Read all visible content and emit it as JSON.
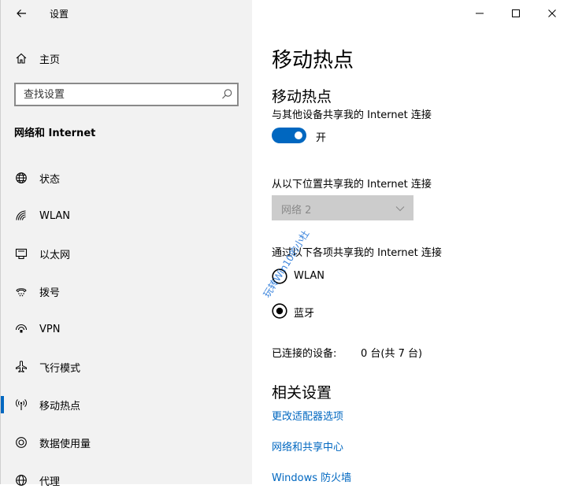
{
  "window": {
    "title": "设置",
    "controls": [
      "minimize",
      "maximize",
      "close"
    ]
  },
  "sidebar": {
    "home_label": "主页",
    "search": {
      "placeholder": "查找设置",
      "value": ""
    },
    "section_title": "网络和 Internet",
    "items": [
      {
        "label": "状态",
        "icon": "globe-icon"
      },
      {
        "label": "WLAN",
        "icon": "wifi-icon"
      },
      {
        "label": "以太网",
        "icon": "ethernet-icon"
      },
      {
        "label": "拨号",
        "icon": "dialup-icon"
      },
      {
        "label": "VPN",
        "icon": "vpn-icon"
      },
      {
        "label": "飞行模式",
        "icon": "airplane-icon"
      },
      {
        "label": "移动热点",
        "icon": "hotspot-icon",
        "active": true
      },
      {
        "label": "数据使用量",
        "icon": "data-usage-icon"
      },
      {
        "label": "代理",
        "icon": "globe-icon"
      }
    ]
  },
  "main": {
    "page_title": "移动热点",
    "section_title": "移动热点",
    "share_desc": "与其他设备共享我的 Internet 连接",
    "toggle": {
      "state": "on",
      "label": "开"
    },
    "from_desc": "从以下位置共享我的 Internet 连接",
    "from_dropdown": {
      "selected": "网络 2",
      "disabled": true
    },
    "via_desc": "通过以下各项共享我的 Internet 连接",
    "via_options": [
      {
        "label": "WLAN",
        "selected": false
      },
      {
        "label": "蓝牙",
        "selected": true
      }
    ],
    "connected_label": "已连接的设备:",
    "connected_value": "0 台(共 7 台)",
    "related_title": "相关设置",
    "related_links": [
      "更改适配器选项",
      "网络和共享中心",
      "Windows 防火墙"
    ]
  },
  "watermark": "玩转Win10的小杜",
  "colors": {
    "accent": "#0067c0",
    "sidebar_bg": "#f2f2f2",
    "disabled_bg": "#cccccc"
  }
}
